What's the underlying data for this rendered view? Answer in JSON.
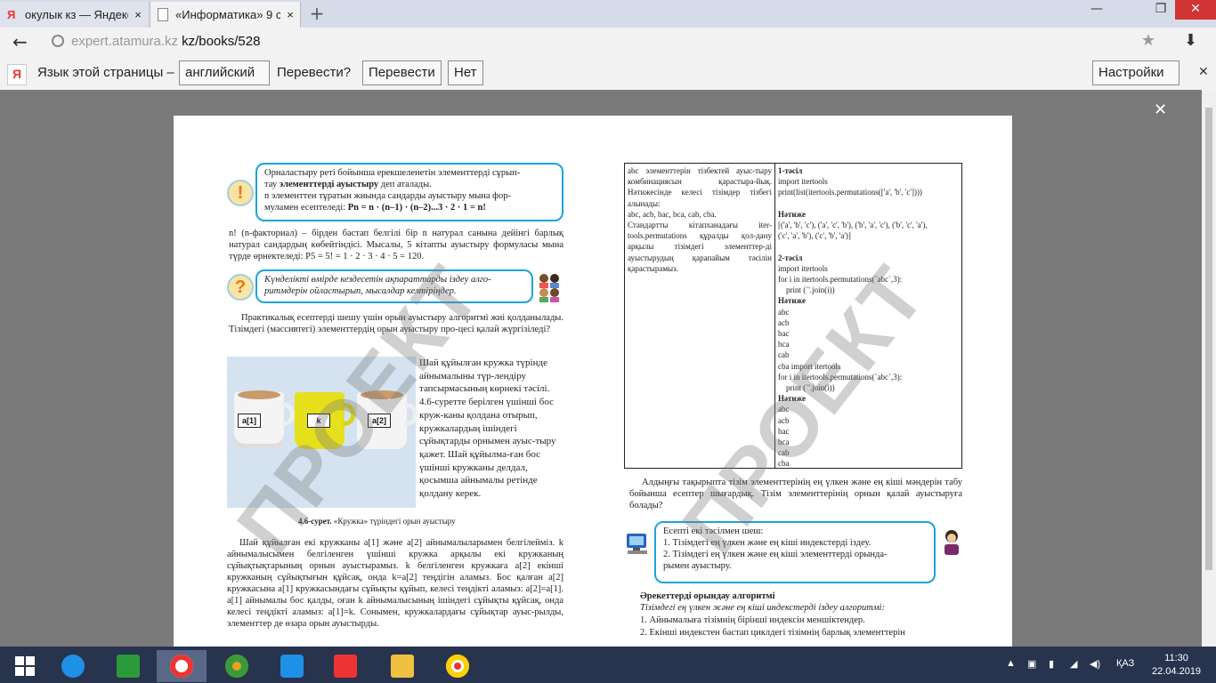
{
  "browser": {
    "tabs": [
      {
        "label": "окулык кз — Яндекс",
        "active": false
      },
      {
        "label": "«Информатика» 9 сы",
        "active": true
      }
    ],
    "new_tab": "+",
    "window": {
      "minimize": "—",
      "restore": "❐",
      "close": "✕"
    },
    "url_host": "expert.atamura.kz",
    "url_path": "kz/books/528",
    "star": "★",
    "download": "⬇"
  },
  "translate_bar": {
    "prompt": "Язык этой страницы –",
    "language": "английский",
    "question": "Перевести?",
    "translate_button": "Перевести",
    "no_button": "Нет",
    "settings_button": "Настройки",
    "close": "✕"
  },
  "viewer": {
    "close": "✕"
  },
  "page": {
    "bubble1": {
      "icon": "!",
      "line1": "Орналастыру реті бойынша ерекшеленетін элементтерді сұрып-",
      "line2a": "тау ",
      "line2b": "элементтерді ауыстыру",
      "line2c": " деп аталады.",
      "line3": " n элементтен тұратын жиында сандарды ауыстыру мына фор-",
      "line4a": "муламен есептеледі: ",
      "line4b": "Pn = n · (n–1) · (n–2)...3 · 2 · 1 = n!"
    },
    "para1": "n! (n-факториал) – бірден бастап белгілі бір n натурал санына дейінгі барлық натурал сандардың көбейтіндісі. Мысалы, 5 кітапты ауыстыру формуласы мына түрде өрнектеледі: P5 = 5! = 1 · 2 · 3 · 4 · 5 = 120.",
    "bubble2": {
      "icon": "?",
      "text": "Күнделікті өмірде кездесетін ақпараттарды іздеу алго-ритмдерін ойластырып, мысалдар келтіріңдер."
    },
    "para2": "Практикалық есептерді шешу үшін орын ауыстыру алгоритмі жиі қолданылады. Тізімдегі (массивтегі) элементтердің орын ауыстыру про-цесі қалай жүргізіледі?",
    "cups": {
      "a1": "a[1]",
      "k": "k",
      "a2": "a[2]"
    },
    "cup_text": "Шай құйылған кружка түрінде айнымалыны түр-лендіру тапсырмасының көрнекі тәсілі. 4.6-суретте берілген үшінші бос круж-каны қолдана отырып, кружкалардың ішіндегі сұйықтарды орнымен ауыс-тыру қажет. Шай құйылма-ған бос үшінші кружканы делдал, қосымша айнымалы ретінде қолдану керек.",
    "caption_bold": "4.6-сурет.",
    "caption_text": " «Кружка» түріндегі орын ауыстыру",
    "para3": "Шай құйылған екі кружканы a[1] және a[2] айнымалыларымен белгілейміз. k айнымалысымен белгіленген үшінші кружка арқылы екі кружканың сұйықтықтарының орнын ауыстырамыз. k белгіленген кружкаға a[2] екінші кружканың сұйықтығын құйсақ, онда k=a[2] теңдігін аламыз. Бос қалған a[2] кружкасына a[1] кружкасындағы сұйықты құйып, келесі теңдікті аламыз: a[2]=a[1]. a[1] айнымалы бос қалды, оған k айнымалысының ішіндегі сұйықты құйсақ, онда келесі теңдікті аламыз: a[1]=k. Сонымен, кружкалардағы сұйықтар ауыс-рылды, элементтер де өзара орын ауыстырды.",
    "table_left": "abc элементтерін тізбектей ауыс-тыру комбинациясын қарастыра-йық. Нәтижесінде келесі тізімдер тізбегі алынады:\nabc, acb, bac, bca, cab, cba.\nСтандартты кітапханадағы iter-tools.permutations құралды қол-дану арқылы тізімдегі элементтер-ді ауыстырудың қарапайым тәсілін қарастырамыз.",
    "table_right": [
      "1-тәсіл",
      "import itertools",
      "print(list(itertools.permutations(['a', 'b', 'c'])))",
      "",
      "Нәтиже",
      "[('a', 'b', 'c'), ('a', 'c', 'b'), ('b', 'a', 'c'), ('b', 'c', 'a'),",
      "('c', 'a', 'b'), ('c', 'b', 'a')]",
      "",
      "2-тәсіл",
      "import itertools",
      "for i in itertools.permutations(`abc`,3):",
      "    print (`'.join(i))",
      "Нәтиже",
      "abc",
      "acb",
      "bac",
      "bca",
      "cab",
      "cba import itertools",
      "for i in itertools.permutations(`abc`,3):",
      "    print (`'.join(i))",
      "Нәтиже",
      "abc",
      "acb",
      "bac",
      "bca",
      "cab",
      "cba"
    ],
    "para4": "Алдыңғы тақырыпта тізім элементтерінің ең үлкен және ең кіші мәндерін табу бойынша есептер шығардық. Тізім элементтерінің орнын қалай ауыстыруға болады?",
    "bubble3": [
      "Есепті екі тәсілмен шеш:",
      "1. Тізімдегі ең үлкен және ең кіші индекстерді іздеу.",
      "2. Тізімдегі ең үлкен және ең кіші элементтерді орында-",
      "рымен ауыстыру."
    ],
    "algo_title": "Әрекеттерді орындау алгоритмі",
    "algo_subtitle": "Тізімдегі ең үлкен және ең кіші индекстерді іздеу алгоритмі:",
    "algo_steps": [
      "1.  Айнымалыға тізімнің бірінші индексін меншіктендер.",
      "2.  Екінші индекстен бастап циклдегі тізімнің барлық элементтерін"
    ],
    "watermark": "ПРОЕКТ"
  },
  "taskbar": {
    "tray_lang": "ҚАЗ",
    "time": "11:30",
    "date": "22.04.2019"
  }
}
